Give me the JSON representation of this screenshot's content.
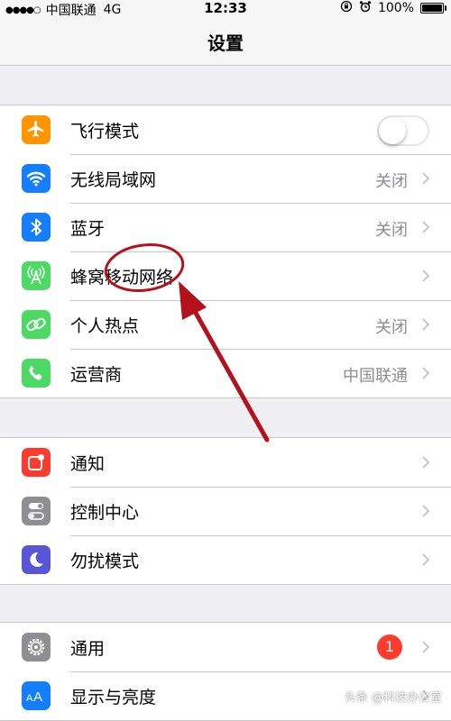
{
  "status_bar": {
    "carrier": "中国联通",
    "network": "4G",
    "time": "12:33",
    "battery": "100%"
  },
  "nav": {
    "title": "设置"
  },
  "group1": [
    {
      "label": "飞行模式",
      "icon": "airplane-icon",
      "color": "#ff9500",
      "toggle": false
    },
    {
      "label": "无线局域网",
      "icon": "wifi-icon",
      "color": "#147efb",
      "value": "关闭"
    },
    {
      "label": "蓝牙",
      "icon": "bluetooth-icon",
      "color": "#147efb",
      "value": "关闭"
    },
    {
      "label": "蜂窝移动网络",
      "icon": "cellular-icon",
      "color": "#4cd964",
      "value": ""
    },
    {
      "label": "个人热点",
      "icon": "hotspot-icon",
      "color": "#4cd964",
      "value": "关闭"
    },
    {
      "label": "运营商",
      "icon": "phone-icon",
      "color": "#4cd964",
      "value": "中国联通"
    }
  ],
  "group2": [
    {
      "label": "通知",
      "icon": "notifications-icon",
      "color": "#ff3b30"
    },
    {
      "label": "控制中心",
      "icon": "control-center-icon",
      "color": "#8e8e93"
    },
    {
      "label": "勿扰模式",
      "icon": "moon-icon",
      "color": "#5856d6"
    }
  ],
  "group3": [
    {
      "label": "通用",
      "icon": "gear-icon",
      "color": "#8e8e93",
      "badge": "1"
    },
    {
      "label": "显示与亮度",
      "icon": "display-brightness-icon",
      "color": "#147efb"
    }
  ],
  "watermark": "头条 @科技办公室"
}
